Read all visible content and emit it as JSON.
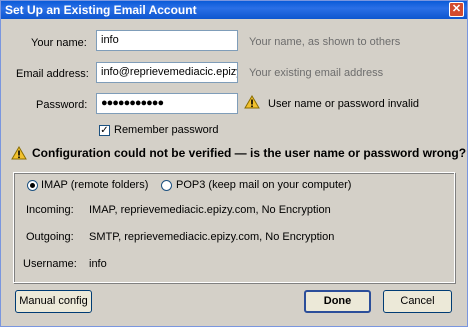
{
  "window": {
    "title": "Set Up an Existing Email Account"
  },
  "form": {
    "name_label": "Your name:",
    "name_value": "info",
    "name_hint": "Your name, as shown to others",
    "email_label": "Email address:",
    "email_value": "info@reprievemediacic.epizy.",
    "email_hint": "Your existing email address",
    "password_label": "Password:",
    "password_value": "●●●●●●●●●●●",
    "password_warning": "User name or password invalid",
    "remember_label": "Remember password",
    "remember_checked": true
  },
  "banner": {
    "text": "Configuration could not be verified — is the user name or password wrong?"
  },
  "server": {
    "imap_label": "IMAP (remote folders)",
    "pop3_label": "POP3 (keep mail on your computer)",
    "selected": "IMAP",
    "incoming_label": "Incoming:",
    "incoming_value": "IMAP, reprievemediacic.epizy.com, No Encryption",
    "outgoing_label": "Outgoing:",
    "outgoing_value": "SMTP, reprievemediacic.epizy.com, No Encryption",
    "username_label": "Username:",
    "username_value": "info"
  },
  "buttons": {
    "manual": "Manual config",
    "done": "Done",
    "cancel": "Cancel"
  },
  "colors": {
    "titlebar": "#0a5bd8",
    "warning": "#f2c12e",
    "dialog_bg": "#d4d0c8"
  }
}
